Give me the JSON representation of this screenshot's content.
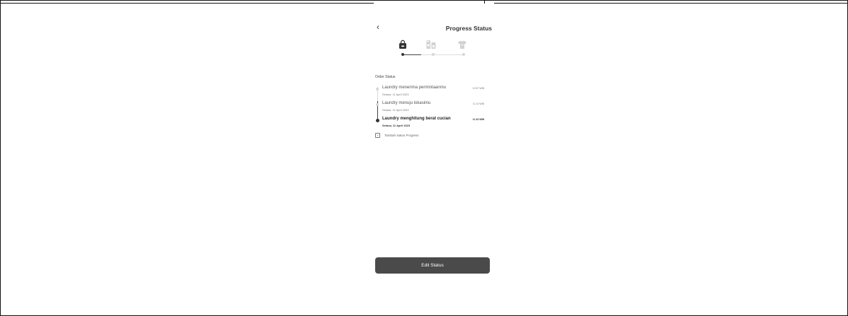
{
  "header": {
    "back_icon": "chevron-left-icon",
    "back_glyph": "‹",
    "title": "Progress Status"
  },
  "steps": {
    "icons": [
      "laundry-bag-icon",
      "washing-machine-icon",
      "tshirt-icon"
    ],
    "active_step": 1,
    "total_steps": 3,
    "progress_fraction": 0.3
  },
  "order_status": {
    "label": "Order Status",
    "items": [
      {
        "title": "Laundry menerima permintaanmu",
        "date": "Selasa, 11 April 2023",
        "time": "10.57 WIB",
        "current": false
      },
      {
        "title": "Laundry menuju lokasimu",
        "date": "Selasa, 11 April 2023",
        "time": "11.10 WIB",
        "current": false
      },
      {
        "title": "Laundry menghitung berat cucian",
        "date": "Selasa, 11 April 2023",
        "time": "11.33 WIB",
        "current": true
      }
    ],
    "add_icon": "plus-square-icon",
    "add_glyph": "+",
    "add_label": "Tambah status Progress"
  },
  "footer": {
    "edit_label": "Edit Status"
  },
  "colors": {
    "primary": "#4a4a4a",
    "active": "#333333",
    "inactive": "#d6d6d6",
    "background": "#ffffff"
  }
}
